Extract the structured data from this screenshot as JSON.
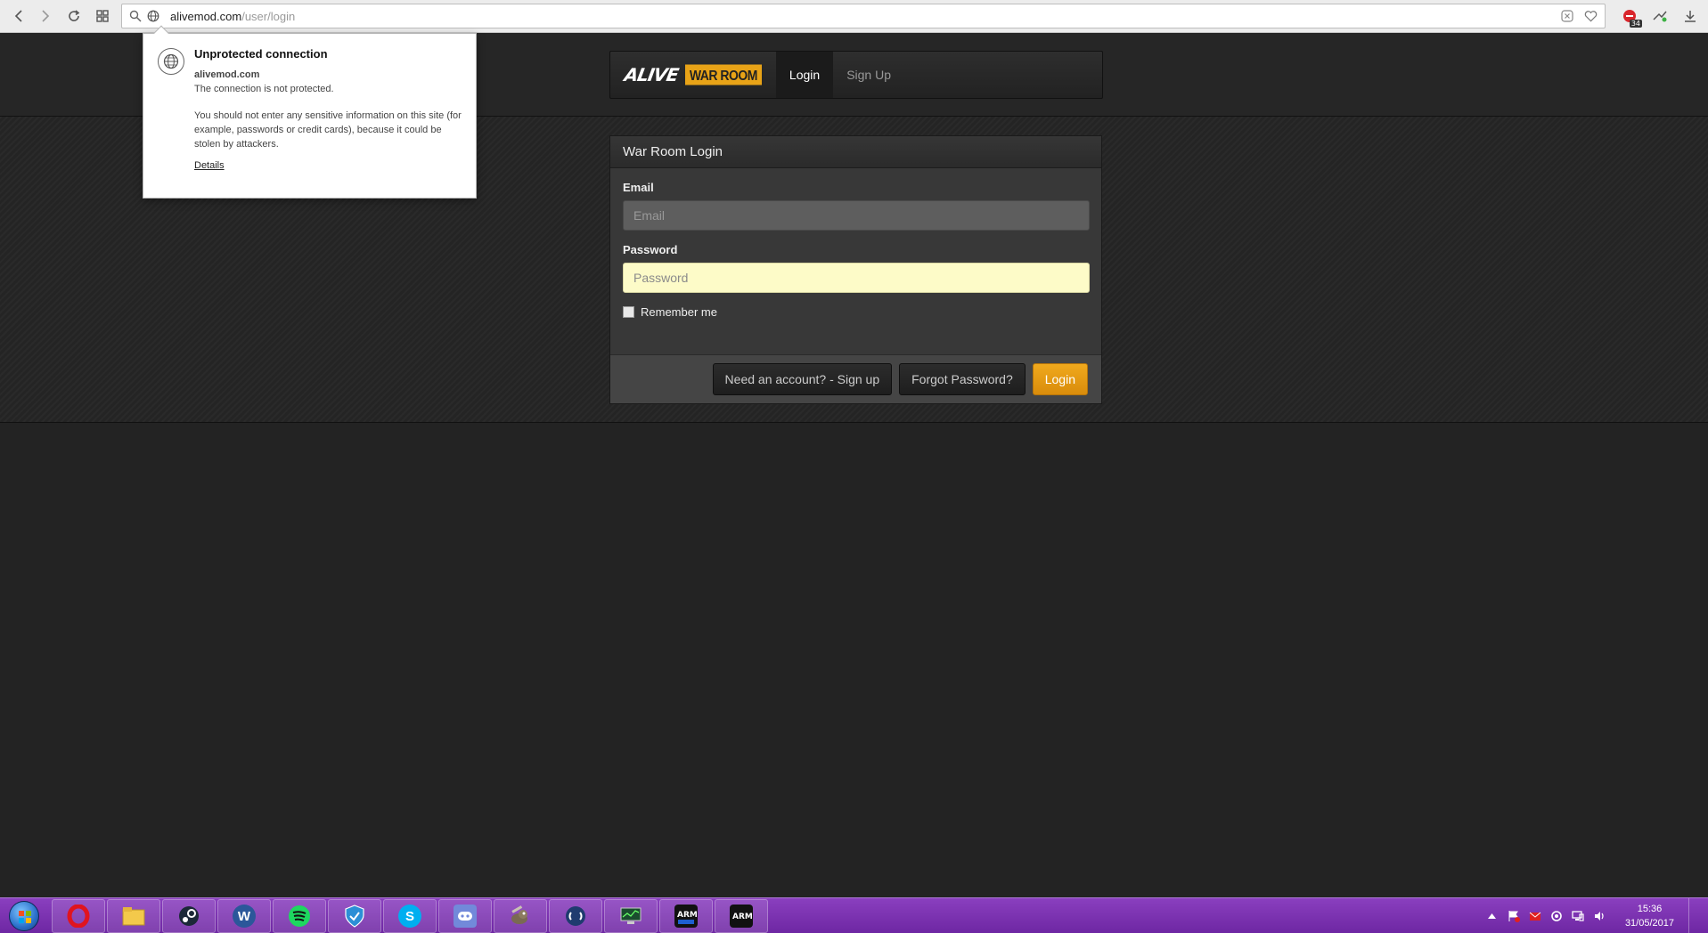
{
  "browser": {
    "url_host": "alivemod.com",
    "url_path": "/user/login",
    "extension_badge": "34"
  },
  "popup": {
    "title": "Unprotected connection",
    "domain": "alivemod.com",
    "status": "The connection is not protected.",
    "warning": "You should not enter any sensitive information on this site (for example, passwords or credit cards), because it could be stolen by attackers.",
    "details_link": "Details"
  },
  "site_nav": {
    "logo_text": "ALIVE",
    "badge_text": "WAR ROOM",
    "links": [
      {
        "label": "Login",
        "active": true
      },
      {
        "label": "Sign Up",
        "active": false
      }
    ]
  },
  "login_panel": {
    "heading": "War Room Login",
    "email_label": "Email",
    "email_placeholder": "Email",
    "password_label": "Password",
    "password_placeholder": "Password",
    "remember_label": "Remember me",
    "signup_button": "Need an account? - Sign up",
    "forgot_button": "Forgot Password?",
    "login_button": "Login"
  },
  "taskbar": {
    "items": [
      "opera",
      "file-explorer",
      "steam",
      "wordpad",
      "spotify",
      "security-shield",
      "skype",
      "discord",
      "gimp",
      "teamspeak",
      "system-monitor",
      "arma3sync",
      "arma3"
    ],
    "time": "15:36",
    "date": "31/05/2017"
  },
  "colors": {
    "accent": "#e8a317",
    "taskbar": "#7a32b0",
    "page_bg": "#232323",
    "password_field": "#fdfbc8"
  }
}
